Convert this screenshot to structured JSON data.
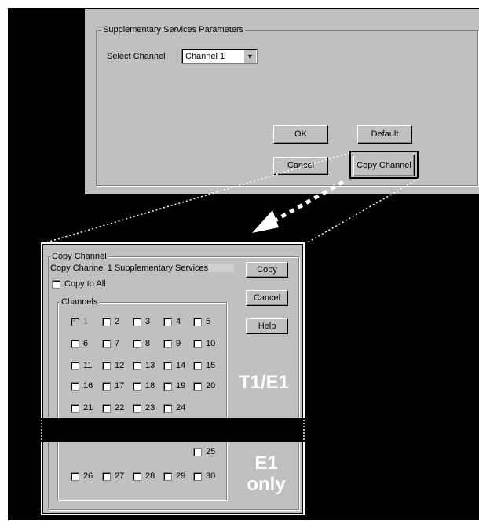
{
  "top_dialog": {
    "group_title": "Supplementary Services Parameters",
    "select_label": "Select Channel",
    "select_value": "Channel 1",
    "ok_label": "OK",
    "default_label": "Default",
    "cancel_label": "Cancel",
    "copy_channel_label": "Copy Channel"
  },
  "bottom_dialog": {
    "group_title": "Copy Channel",
    "subtitle": "Copy Channel 1 Supplementary Services",
    "copy_to_all_label": "Copy to All",
    "channels_title": "Channels",
    "copy_label": "Copy",
    "cancel_label": "Cancel",
    "help_label": "Help",
    "channels": [
      "1",
      "2",
      "3",
      "4",
      "5",
      "6",
      "7",
      "8",
      "9",
      "10",
      "11",
      "12",
      "13",
      "14",
      "15",
      "16",
      "17",
      "18",
      "19",
      "20",
      "21",
      "22",
      "23",
      "24",
      "25",
      "26",
      "27",
      "28",
      "29",
      "30"
    ]
  },
  "annotations": {
    "t1e1": "T1/E1",
    "e1_line1": "E1",
    "e1_line2": "only"
  }
}
